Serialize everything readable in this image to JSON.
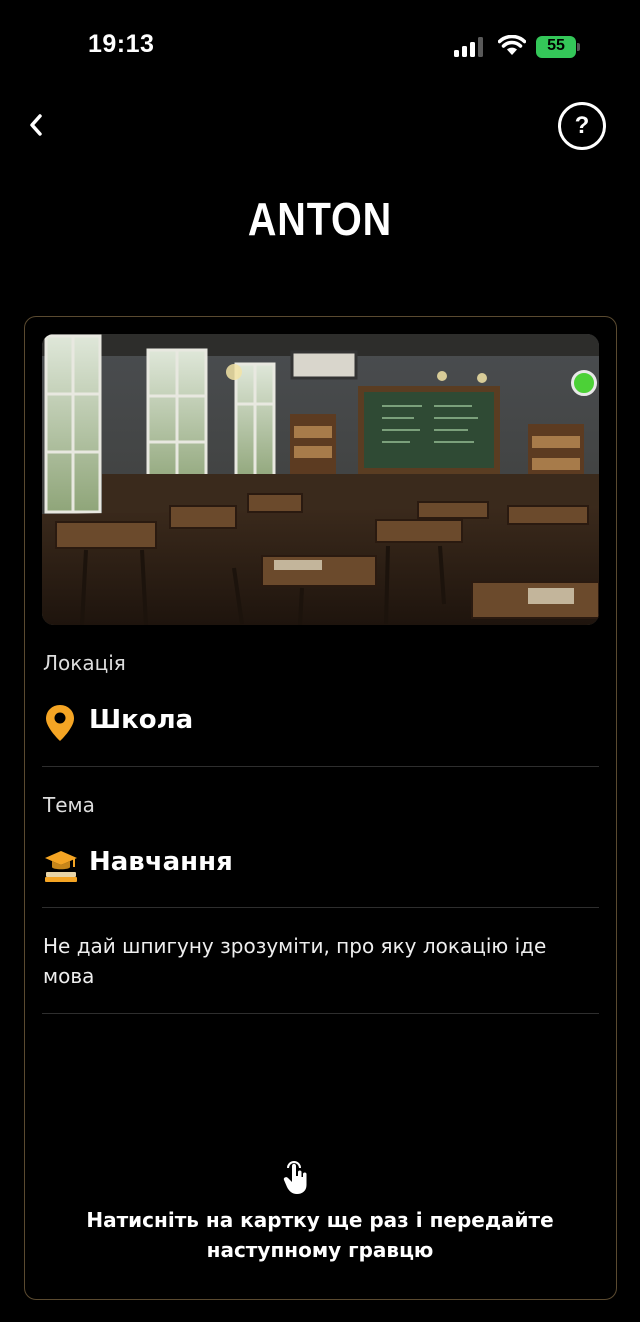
{
  "status_bar": {
    "time": "19:13",
    "battery": "55"
  },
  "header": {
    "back_icon": "chevron-left-icon",
    "help_label": "?"
  },
  "player": {
    "name": "ANTON"
  },
  "card": {
    "image": "classroom-illustration",
    "status_color": "#4cd137",
    "location": {
      "label": "Локація",
      "icon": "map-pin-icon",
      "icon_color": "#f5a524",
      "value": "Школа"
    },
    "theme": {
      "label": "Тема",
      "icon": "graduation-cap-books-icon",
      "value": "Навчання"
    },
    "hint": "Не дай шпигуну зрозуміти, про яку локацію іде мова",
    "footer_icon": "tap-hand-icon",
    "footer": "Натисніть на картку ще раз і передайте наступному гравцю"
  },
  "colors": {
    "background": "#000000",
    "card_border": "#5a4a30",
    "accent": "#f5a524"
  }
}
